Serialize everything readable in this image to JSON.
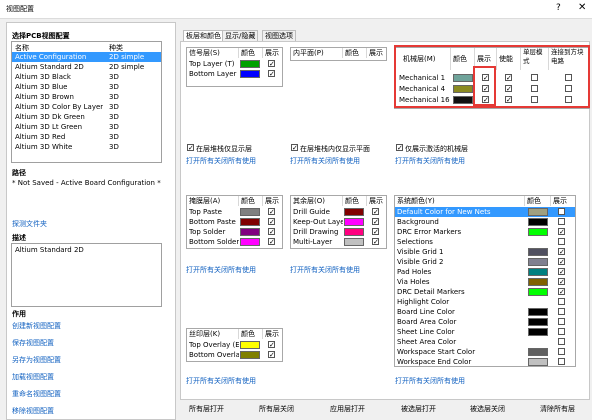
{
  "window": {
    "title": "视图配置",
    "help": "?",
    "close": "✕"
  },
  "left": {
    "select_title": "选择PCB视图配置",
    "col_name": "名称",
    "col_type": "种类",
    "configs": [
      {
        "name": "Active Configuration",
        "type": "2D simple",
        "selected": true
      },
      {
        "name": "Altium Standard 2D",
        "type": "2D simple"
      },
      {
        "name": "Altium 3D Black",
        "type": "3D"
      },
      {
        "name": "Altium 3D Blue",
        "type": "3D"
      },
      {
        "name": "Altium 3D Brown",
        "type": "3D"
      },
      {
        "name": "Altium 3D Color By Layer",
        "type": "3D"
      },
      {
        "name": "Altium 3D Dk Green",
        "type": "3D"
      },
      {
        "name": "Altium 3D Lt Green",
        "type": "3D"
      },
      {
        "name": "Altium 3D Red",
        "type": "3D"
      },
      {
        "name": "Altium 3D White",
        "type": "3D"
      }
    ],
    "path_title": "路径",
    "path_value": "* Not Saved - Active Board Configuration *",
    "explore_link": "探测文件夹",
    "desc_title": "描述",
    "desc_value": "Altium Standard 2D",
    "actions_title": "作用",
    "actions": [
      "创建新视图配置",
      "保存视图配置",
      "另存为视图配置",
      "加载视图配置",
      "重命名视图配置",
      "移除视图配置"
    ]
  },
  "tabs": [
    "板层和颜色",
    "显示/隐藏",
    "视图选项"
  ],
  "signal": {
    "h_name": "信号层(S)",
    "h_color": "颜色",
    "h_show": "展示",
    "rows": [
      {
        "name": "Top Layer (T)",
        "color": "#00a000",
        "show": true
      },
      {
        "name": "Bottom Layer (B)",
        "color": "#0000ff",
        "show": true
      }
    ]
  },
  "internal": {
    "h_name": "内平面(P)",
    "h_color": "颜色",
    "h_show": "展示"
  },
  "mech": {
    "h_name": "机械层(M)",
    "h_color": "颜色",
    "h_show": "展示",
    "h_enable": "使能",
    "h_single": "单层模式",
    "h_linked": "连接到方块电路",
    "rows": [
      {
        "name": "Mechanical 1",
        "color": "#6fa39a",
        "show": true,
        "enable": true,
        "single": false,
        "linked": false
      },
      {
        "name": "Mechanical 4",
        "color": "#8b8b22",
        "show": true,
        "enable": true,
        "single": false,
        "linked": false
      },
      {
        "name": "Mechanical 16",
        "color": "#111111",
        "show": true,
        "enable": true,
        "single": false,
        "linked": false
      }
    ]
  },
  "options": {
    "opt1": "在层堆栈仅显示层",
    "opt2": "在层堆栈内仅显示平面",
    "opt3": "仅展示激活的机械层",
    "link_all": "打开所有关闭所有使用"
  },
  "mask": {
    "h_name": "掩膜层(A)",
    "h_color": "颜色",
    "h_show": "展示",
    "rows": [
      {
        "name": "Top Paste",
        "color": "#808080",
        "show": true
      },
      {
        "name": "Bottom Paste",
        "color": "#800000",
        "show": true
      },
      {
        "name": "Top Solder",
        "color": "#800080",
        "show": true
      },
      {
        "name": "Bottom Solder",
        "color": "#ff00ff",
        "show": true
      }
    ]
  },
  "other": {
    "h_name": "其余层(O)",
    "h_color": "颜色",
    "h_show": "展示",
    "rows": [
      {
        "name": "Drill Guide",
        "color": "#800000",
        "show": true
      },
      {
        "name": "Keep-Out Layer",
        "color": "#ff00ff",
        "show": true
      },
      {
        "name": "Drill Drawing",
        "color": "#ff0080",
        "show": true
      },
      {
        "name": "Multi-Layer",
        "color": "#c0c0c0",
        "show": true
      }
    ]
  },
  "system": {
    "h_name": "系统颜色(Y)",
    "h_color": "颜色",
    "h_show": "展示",
    "rows": [
      {
        "name": "Default Color for New Nets",
        "color": "#a0a080",
        "show": true,
        "selected": true
      },
      {
        "name": "Background",
        "color": "#000000",
        "show": false
      },
      {
        "name": "DRC Error Markers",
        "color": "#00ff00",
        "show": true
      },
      {
        "name": "Selections",
        "color": "",
        "show": false
      },
      {
        "name": "Visible Grid 1",
        "color": "#505060",
        "show": true
      },
      {
        "name": "Visible Grid 2",
        "color": "#808090",
        "show": true
      },
      {
        "name": "Pad Holes",
        "color": "#008080",
        "show": true
      },
      {
        "name": "Via Holes",
        "color": "#806000",
        "show": true
      },
      {
        "name": "DRC Detail Markers",
        "color": "#00ff00",
        "show": true
      },
      {
        "name": "Highlight Color",
        "color": "",
        "show": false
      },
      {
        "name": "Board Line Color",
        "color": "#000000",
        "show": false
      },
      {
        "name": "Board Area Color",
        "color": "#000000",
        "show": false
      },
      {
        "name": "Sheet Line Color",
        "color": "#000000",
        "show": false
      },
      {
        "name": "Sheet Area Color",
        "color": "",
        "show": false
      },
      {
        "name": "Workspace Start Color",
        "color": "#606060",
        "show": false
      },
      {
        "name": "Workspace End Color",
        "color": "#c0c0c0",
        "show": false
      }
    ]
  },
  "silk": {
    "h_name": "丝印层(K)",
    "h_color": "颜色",
    "h_show": "展示",
    "rows": [
      {
        "name": "Top Overlay (E)",
        "color": "#ffff00",
        "show": true
      },
      {
        "name": "Bottom Overlay (R)",
        "color": "#808000",
        "show": true
      }
    ]
  },
  "bottom_buttons": [
    "所有层打开",
    "所有层关闭",
    "应用层打开",
    "被选层打开",
    "被选层关闭",
    "清除所有层"
  ]
}
